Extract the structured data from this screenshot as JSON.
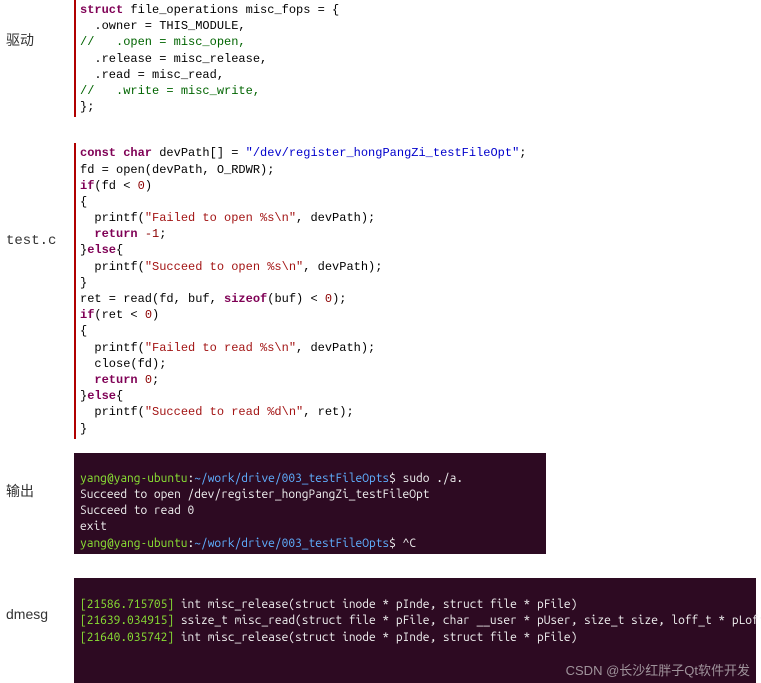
{
  "labels": {
    "driver": "驱动",
    "testc": "test.c",
    "output": "输出",
    "dmesg": "dmesg"
  },
  "driver_code": {
    "l1_a": "struct",
    "l1_b": " file_operations misc_fops = {",
    "l2": "  .owner = THIS_MODULE,",
    "l3": "//   .open = misc_open,",
    "l4": "  .release = misc_release,",
    "l5": "  .read = misc_read,",
    "l6": "//   .write = misc_write,",
    "l7": "};"
  },
  "test_code": {
    "l1_a": "const char",
    "l1_b": " devPath[] = ",
    "l1_c": "\"/dev/register_hongPangZi_testFileOpt\"",
    "l1_d": ";",
    "l2": "fd = open(devPath, O_RDWR);",
    "l3_a": "if",
    "l3_b": "(fd < ",
    "l3_c": "0",
    "l3_d": ")",
    "l4": "{",
    "l5_a": "  printf(",
    "l5_b": "\"Failed to open %s\\n\"",
    "l5_c": ", devPath);",
    "l6_a": "  return ",
    "l6_b": "-1",
    "l6_c": ";",
    "l7_a": "}",
    "l7_b": "else",
    "l7_c": "{",
    "l8_a": "  printf(",
    "l8_b": "\"Succeed to open %s\\n\"",
    "l8_c": ", devPath);",
    "l9": "}",
    "l10_a": "ret = read(fd, buf, ",
    "l10_b": "sizeof",
    "l10_c": "(buf) < ",
    "l10_d": "0",
    "l10_e": ");",
    "l11_a": "if",
    "l11_b": "(ret < ",
    "l11_c": "0",
    "l11_d": ")",
    "l12": "{",
    "l13_a": "  printf(",
    "l13_b": "\"Failed to read %s\\n\"",
    "l13_c": ", devPath);",
    "l14": "  close(fd);",
    "l15_a": "  return ",
    "l15_b": "0",
    "l15_c": ";",
    "l16_a": "}",
    "l16_b": "else",
    "l16_c": "{",
    "l17_a": "  printf(",
    "l17_b": "\"Succeed to read %d\\n\"",
    "l17_c": ", ret);",
    "l18": "}"
  },
  "terminal": {
    "l1_a": "yang@yang-ubuntu",
    "l1_b": ":",
    "l1_c": "~/work/drive/003_testFileOpts",
    "l1_d": "$ sudo ./a.",
    "l2": "Succeed to open /dev/register_hongPangZi_testFileOpt",
    "l3": "Succeed to read 0",
    "l4": "exit",
    "l5_a": "yang@yang-ubuntu",
    "l5_b": ":",
    "l5_c": "~/work/drive/003_testFileOpts",
    "l5_d": "$ ^C"
  },
  "dmesg": {
    "l1_a": "[21586.715705]",
    "l1_b": " int misc_release(struct inode * pInde, struct file * pFile)",
    "l2_a": "[21639.034915]",
    "l2_b": " ssize_t misc_read(struct file * pFile, char __user * pUser, size_t size, loff_t * pLofft)",
    "l3_a": "[21640.035742]",
    "l3_b": " int misc_release(struct inode * pInde, struct file * pFile)"
  },
  "watermark": "CSDN @长沙红胖子Qt软件开发"
}
